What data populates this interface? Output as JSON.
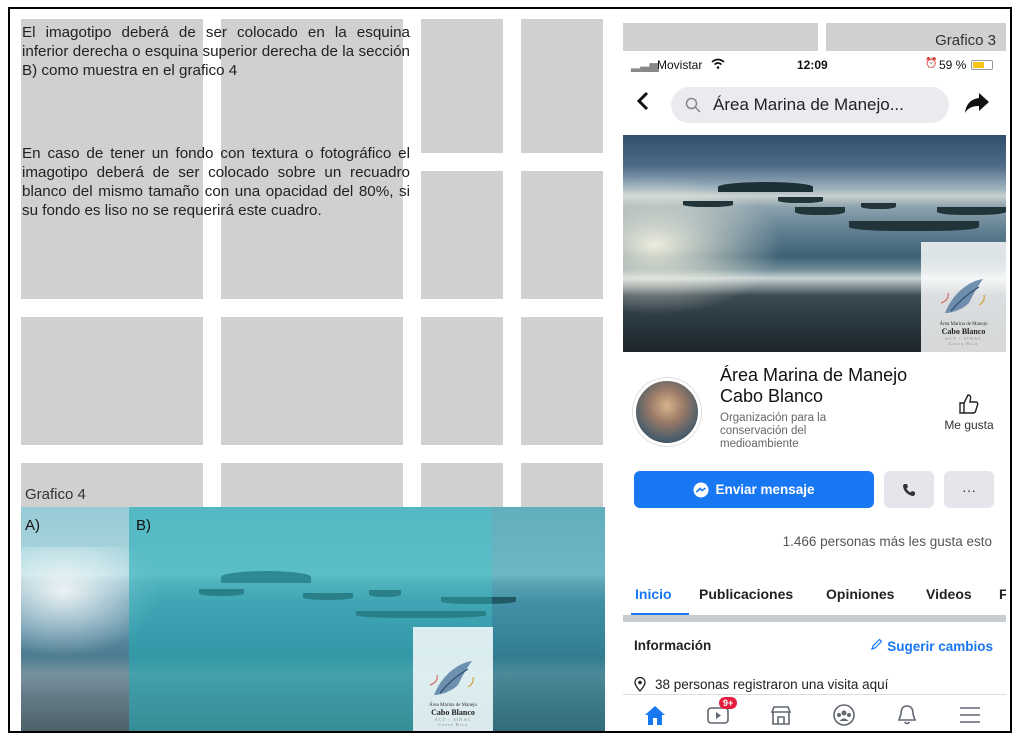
{
  "left": {
    "paragraph1": "El imagotipo deberá de ser colocado en la esquina inferior derecha o esquina superior derecha de la sección B) como muestra en el grafico 4",
    "paragraph2": "En caso de tener un fondo con textura o fotográfico el imagotipo deberá de ser colocado sobre un recuadro blanco del mismo tamaño con una opacidad del 80%, si su fondo es liso no se requerirá este cuadro.",
    "grafico4_label": "Grafico 4",
    "section_a": "A)",
    "section_b": "B)"
  },
  "logo": {
    "line1": "Área Marina de Manejo",
    "line2": "Cabo Blanco",
    "line3": "ACT - SINAC",
    "line4": "Costa Rica"
  },
  "phone": {
    "grafico3_label": "Grafico 3",
    "status": {
      "carrier": "Movistar",
      "time": "12:09",
      "battery": "59 %"
    },
    "search_text": "Área Marina de Manejo...",
    "page_name": "Área Marina de Manejo Cabo Blanco",
    "category": "Organización para la conservación del medioambiente",
    "like_label": "Me gusta",
    "message_button": "Enviar mensaje",
    "more_label": "···",
    "likes_text": "1.466 personas más les gusta esto",
    "tabs": [
      "Inicio",
      "Publicaciones",
      "Opiniones",
      "Videos",
      "F"
    ],
    "info_heading": "Información",
    "suggest_label": "Sugerir cambios",
    "visit_text": "38 personas registraron una visita aquí",
    "badge": "9+"
  },
  "colors": {
    "facebook_blue": "#1877f2",
    "grid_gray": "#d0d0d0",
    "teal_overlay": "#2eb0ba"
  }
}
